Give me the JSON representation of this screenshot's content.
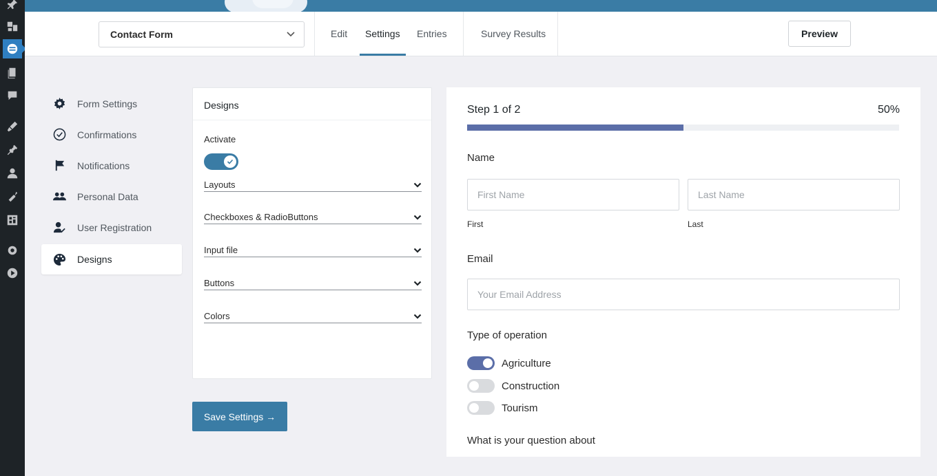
{
  "header": {
    "form_selector": "Contact Form",
    "tabs": [
      {
        "label": "Edit"
      },
      {
        "label": "Settings"
      },
      {
        "label": "Entries"
      },
      {
        "label": "Survey Results"
      }
    ],
    "active_tab": "Settings",
    "preview_label": "Preview"
  },
  "settings_nav": {
    "items": [
      {
        "label": "Form Settings",
        "icon": "gear-icon"
      },
      {
        "label": "Confirmations",
        "icon": "check-circle-icon"
      },
      {
        "label": "Notifications",
        "icon": "flag-icon"
      },
      {
        "label": "Personal Data",
        "icon": "users-icon"
      },
      {
        "label": "User Registration",
        "icon": "user-check-icon"
      },
      {
        "label": "Designs",
        "icon": "palette-icon"
      }
    ],
    "active": "Designs"
  },
  "designs_panel": {
    "title": "Designs",
    "activate_label": "Activate",
    "activate_on": true,
    "sections": [
      "Layouts",
      "Checkboxes & RadioButtons",
      "Input file",
      "Buttons",
      "Colors"
    ]
  },
  "save_button": "Save Settings →",
  "form_preview": {
    "step_text": "Step 1 of 2",
    "progress_text": "50%",
    "progress_value": 0.5,
    "name_label": "Name",
    "first_placeholder": "First Name",
    "last_placeholder": "Last Name",
    "first_sublabel": "First",
    "last_sublabel": "Last",
    "email_label": "Email",
    "email_placeholder": "Your Email Address",
    "operation_label": "Type of operation",
    "operations": [
      {
        "label": "Agriculture",
        "on": true
      },
      {
        "label": "Construction",
        "on": false
      },
      {
        "label": "Tourism",
        "on": false
      }
    ],
    "question_label": "What is your question about"
  },
  "colors": {
    "accent": "#3a7ca5",
    "progress": "#5b6ea8",
    "admin_bg": "#1e2327"
  }
}
